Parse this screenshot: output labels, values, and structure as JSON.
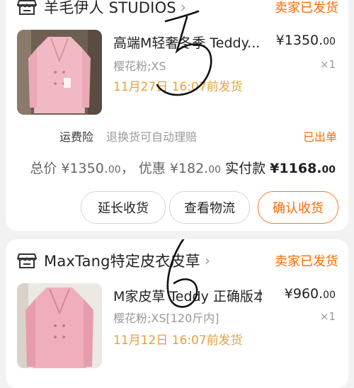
{
  "orders": [
    {
      "shop_name": "羊毛伊人 STUDIOS",
      "status": "卖家已发货",
      "item": {
        "title": "高端M轻奢冬季 Teddy...",
        "price_symbol": "¥",
        "price_int": "1350.",
        "price_dec": "00",
        "spec": "樱花粉;XS",
        "qty": "×1",
        "ship_note": "11月27日 16:07前发货"
      },
      "insurance": {
        "label": "运费险",
        "desc": "退换货可自动理赔",
        "status": "已出单"
      },
      "summary": {
        "total_label": "总价",
        "total_symbol": "¥",
        "total_int": "1350.",
        "total_dec": "00",
        "sep": "，",
        "discount_label": "优惠",
        "discount_symbol": "¥",
        "discount_int": "182.",
        "discount_dec": "00",
        "final_label": "实付款",
        "final_symbol": "¥",
        "final_int": "1168.",
        "final_dec": "00"
      },
      "buttons": [
        "延长收货",
        "查看物流",
        "确认收货"
      ],
      "handwritten": "5"
    },
    {
      "shop_name": "MaxTang特定皮衣皮草",
      "status": "卖家已发货",
      "item": {
        "title": "M家皮草 Teddy 正确版本...",
        "price_symbol": "¥",
        "price_int": "960.",
        "price_dec": "00",
        "spec": "樱花粉;XS[120斤内]",
        "qty": "×1",
        "ship_note": "11月12日 16:07前发货"
      },
      "handwritten": "6"
    }
  ],
  "colors": {
    "accent": "#ff6a00",
    "ship_note": "#e8a03a",
    "coat": "#f1b9c3"
  },
  "icons": {
    "shop": "store-icon",
    "chevron": "chevron-right-icon"
  }
}
